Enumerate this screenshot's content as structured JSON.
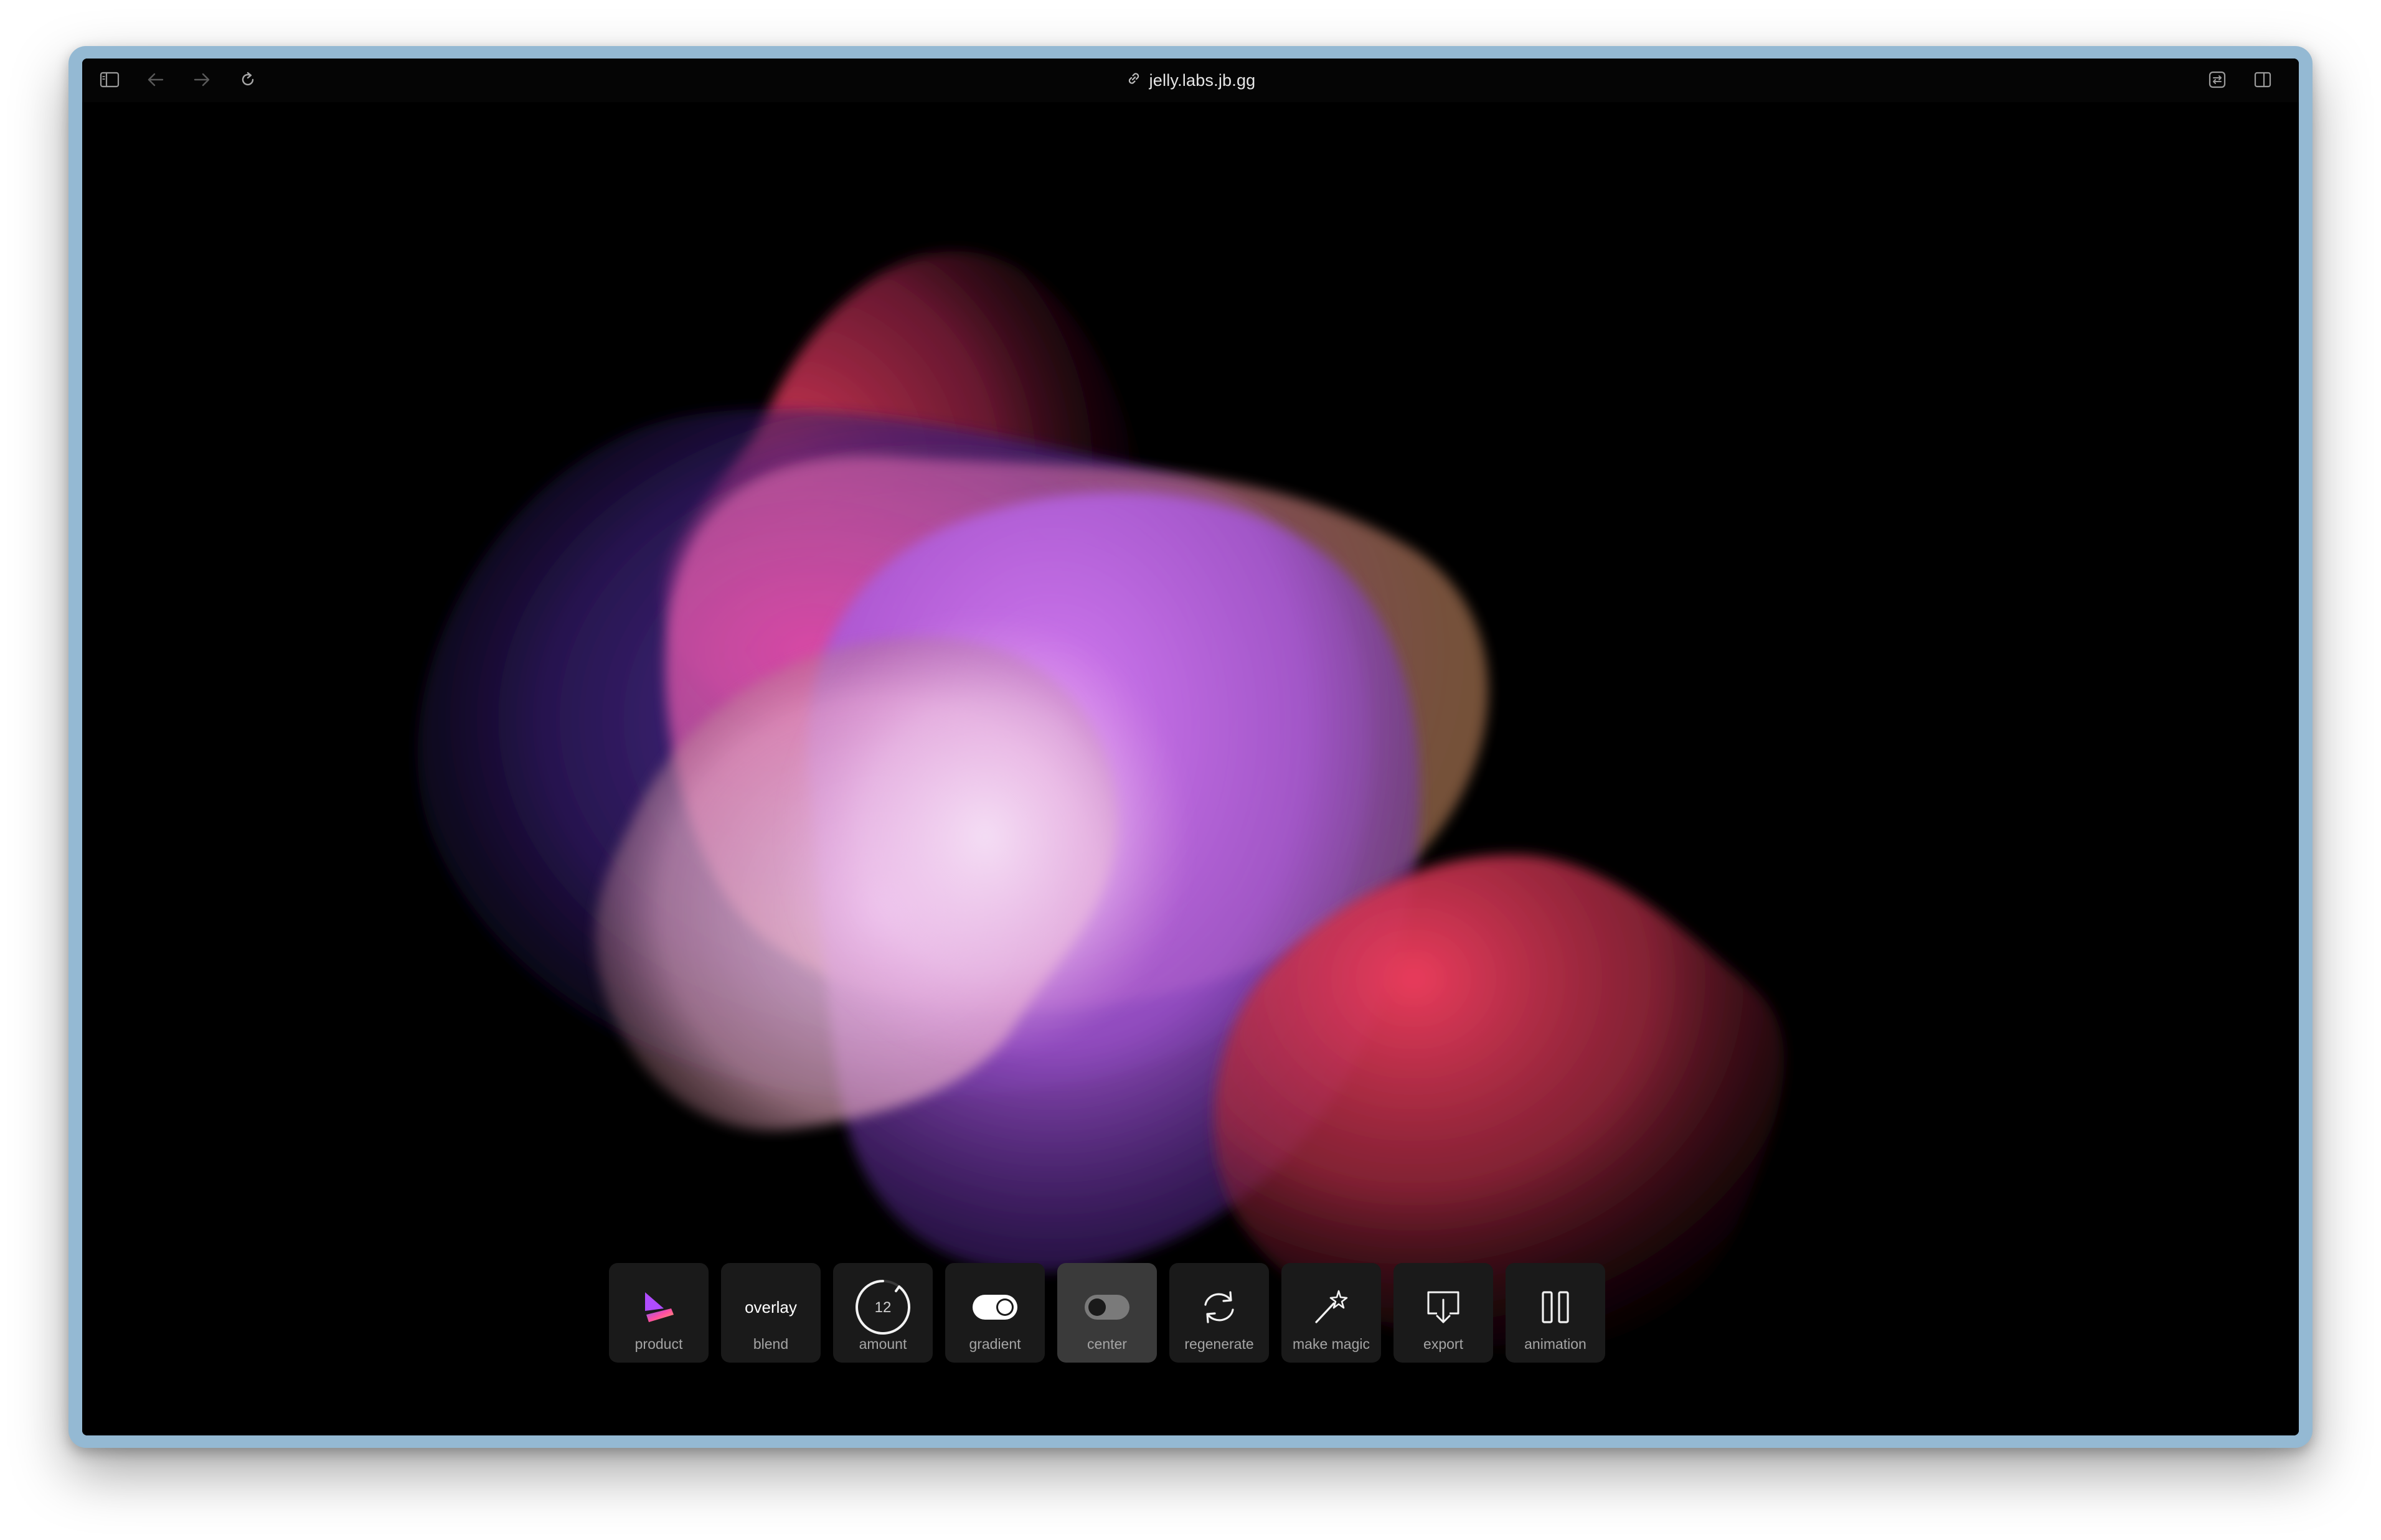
{
  "browser": {
    "url": "jelly.labs.jb.gg",
    "icons": {
      "sidebar": "sidebar-icon",
      "back": "back-arrow-icon",
      "forward": "forward-arrow-icon",
      "reload": "reload-icon",
      "link": "link-icon",
      "translate": "translate-icon",
      "split": "split-view-icon"
    }
  },
  "dock": {
    "product": {
      "label": "product",
      "icon": "product-logo-icon"
    },
    "blend": {
      "label": "blend",
      "value": "overlay"
    },
    "amount": {
      "label": "amount",
      "value": "12"
    },
    "gradient": {
      "label": "gradient",
      "on": true
    },
    "center": {
      "label": "center",
      "on": false
    },
    "regenerate": {
      "label": "regenerate",
      "icon": "regenerate-icon"
    },
    "make_magic": {
      "label": "make magic",
      "icon": "magic-wand-icon"
    },
    "export": {
      "label": "export",
      "icon": "export-icon"
    },
    "animation": {
      "label": "animation",
      "icon": "pause-icon"
    }
  },
  "colors": {
    "background": "#000000",
    "frame": "#94b9d3",
    "dock_item": "#1a1a1a",
    "dock_item_active": "#3a3a3a",
    "blob_red": "#e0405a",
    "blob_violet": "#c070f0",
    "blob_purple": "#6a3ac0",
    "blob_peach": "#f0b0a0"
  }
}
